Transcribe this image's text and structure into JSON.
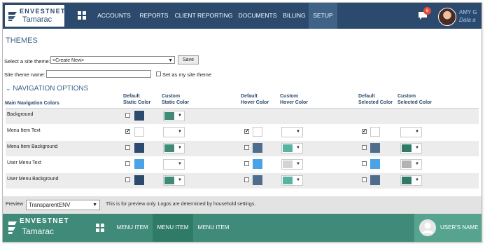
{
  "brand": {
    "line1": "ENVESTNET",
    "line2": "Tamarac",
    "tm": "®"
  },
  "nav": {
    "items": [
      {
        "label": "ACCOUNTS"
      },
      {
        "label": "REPORTS"
      },
      {
        "label": "CLIENT REPORTING"
      },
      {
        "label": "DOCUMENTS"
      },
      {
        "label": "BILLING"
      },
      {
        "label": "SETUP",
        "active": true
      }
    ],
    "notification_count": "6",
    "user_name": "AMY G",
    "user_sub": "Data a"
  },
  "page": {
    "title": "THEMES",
    "select_theme_label": "Select a site theme:",
    "select_theme_value": "<Create New>",
    "save_label": "Save",
    "theme_name_label": "Site theme name:",
    "theme_name_value": "",
    "set_site_theme_label": "Set as my site theme",
    "section_title": "NAVIGATION OPTIONS",
    "section_chevron": "⌄"
  },
  "table": {
    "headers": {
      "main": "Main Navigation Colors",
      "default_static": [
        "Default",
        "Static Color"
      ],
      "custom_static": [
        "Custom",
        "Static Color"
      ],
      "default_hover": [
        "Default",
        "Hover Color"
      ],
      "custom_hover": [
        "Custom",
        "Hover Color"
      ],
      "default_selected": [
        "Default",
        "Selected Color"
      ],
      "custom_selected": [
        "Custom",
        "Selected Color"
      ]
    },
    "rows": [
      {
        "label": "Background",
        "has_hover": false,
        "static": {
          "checked": false,
          "default": "#2c4a6e",
          "custom": "#3f8a78"
        }
      },
      {
        "label": "Menu Item Text",
        "has_hover": true,
        "static": {
          "checked": true,
          "default": "#ffffff",
          "custom": "#ffffff"
        },
        "hover": {
          "checked": true,
          "default": "#ffffff",
          "custom": "#ffffff"
        },
        "selected": {
          "checked": true,
          "default": "#ffffff",
          "custom": "#ffffff"
        }
      },
      {
        "label": "Menu Item Background",
        "has_hover": true,
        "static": {
          "checked": false,
          "default": "#2c4a6e",
          "custom": "#3f8a78"
        },
        "hover": {
          "checked": false,
          "default": "#4f6e8e",
          "custom": "#56b4a0"
        },
        "selected": {
          "checked": false,
          "default": "#4f6e8e",
          "custom": "#2f7b68"
        }
      },
      {
        "label": "User Menu Text",
        "has_hover": true,
        "static": {
          "checked": false,
          "default": "#4aa3e6",
          "custom": "#ffffff"
        },
        "hover": {
          "checked": false,
          "default": "#4aa3e6",
          "custom": "#d4d4d4"
        },
        "selected": {
          "checked": false,
          "default": "#4aa3e6",
          "custom": "#b3b3b3"
        }
      },
      {
        "label": "User Menu Background",
        "has_hover": true,
        "static": {
          "checked": false,
          "default": "#2c4a6e",
          "custom": "#3f8a78"
        },
        "hover": {
          "checked": false,
          "default": "#4f6e8e",
          "custom": "#56b4a0"
        },
        "selected": {
          "checked": false,
          "default": "#4f6e8e",
          "custom": "#2f7b68"
        }
      }
    ]
  },
  "preview": {
    "label": "Preview",
    "select_value": "TransparentENV",
    "note": "This is for preview only. Logos are determined by household settings.",
    "nav_items": [
      {
        "label": "MENU ITEM"
      },
      {
        "label": "MENU ITEM",
        "selected": true
      },
      {
        "label": "MENU ITEM"
      }
    ],
    "user_label": "USER'S NAME"
  },
  "colors": {
    "nav_bg": "#2c4a6e",
    "nav_active": "#3f6287",
    "accent_text": "#3f6287",
    "preview_nav_bg": "#3f8a78",
    "preview_selected": "#2f7b68",
    "badge": "#e84a3b"
  },
  "icons": {
    "apps": "grid-icon",
    "notifications": "chat-bubble-icon",
    "dropdown": "caret-down-icon"
  }
}
